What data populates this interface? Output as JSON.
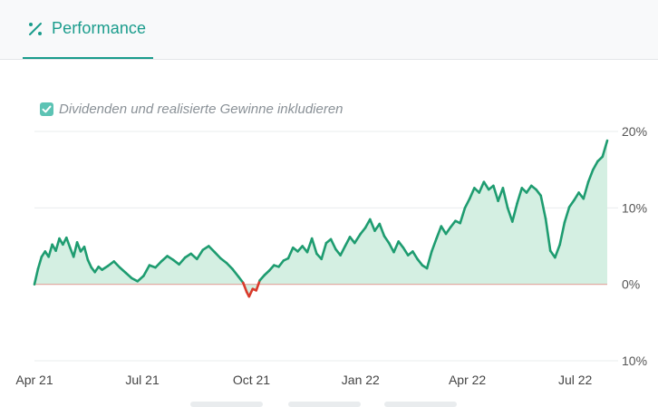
{
  "tab": {
    "label": "Performance",
    "icon": "percent-icon",
    "accent": "#1a9c8c"
  },
  "options": {
    "include_dividends_label": "Dividenden und realisierte Gewinne inkludieren",
    "include_dividends_checked": true
  },
  "chart_data": {
    "type": "area",
    "title": "",
    "xlabel": "",
    "ylabel": "",
    "y_axis_side": "right",
    "y_ticks": [
      20,
      10,
      0,
      -10
    ],
    "y_tick_labels": [
      "20%",
      "10%",
      "0%",
      "10%"
    ],
    "ylim": [
      -10,
      20
    ],
    "x_tick_labels": [
      "Apr 21",
      "Jul 21",
      "Oct 21",
      "Jan 22",
      "Apr 22",
      "Jul 22"
    ],
    "x_tick_dates": [
      "2021-04-01",
      "2021-07-01",
      "2021-10-01",
      "2022-01-01",
      "2022-04-01",
      "2022-07-01"
    ],
    "grid": true,
    "colors": {
      "positive_line": "#1e9c70",
      "positive_fill": "#d4efe2",
      "negative_line": "#d93a2b",
      "negative_fill": "#f6d3cf",
      "zero_line": "#e0a39a"
    },
    "series": [
      {
        "values_unit": "%",
        "points": [
          [
            "2021-04-01",
            0.0
          ],
          [
            "2021-04-04",
            2.0
          ],
          [
            "2021-04-07",
            3.6
          ],
          [
            "2021-04-10",
            4.3
          ],
          [
            "2021-04-13",
            3.6
          ],
          [
            "2021-04-16",
            5.2
          ],
          [
            "2021-04-19",
            4.4
          ],
          [
            "2021-04-22",
            6.0
          ],
          [
            "2021-04-25",
            5.2
          ],
          [
            "2021-04-28",
            6.1
          ],
          [
            "2021-05-01",
            4.8
          ],
          [
            "2021-05-04",
            3.6
          ],
          [
            "2021-05-07",
            5.5
          ],
          [
            "2021-05-10",
            4.3
          ],
          [
            "2021-05-13",
            4.9
          ],
          [
            "2021-05-16",
            3.2
          ],
          [
            "2021-05-19",
            2.2
          ],
          [
            "2021-05-22",
            1.6
          ],
          [
            "2021-05-25",
            2.3
          ],
          [
            "2021-05-28",
            1.9
          ],
          [
            "2021-06-02",
            2.4
          ],
          [
            "2021-06-07",
            3.0
          ],
          [
            "2021-06-12",
            2.2
          ],
          [
            "2021-06-17",
            1.5
          ],
          [
            "2021-06-22",
            0.8
          ],
          [
            "2021-06-27",
            0.4
          ],
          [
            "2021-07-02",
            1.1
          ],
          [
            "2021-07-07",
            2.5
          ],
          [
            "2021-07-12",
            2.2
          ],
          [
            "2021-07-17",
            3.0
          ],
          [
            "2021-07-22",
            3.7
          ],
          [
            "2021-07-27",
            3.2
          ],
          [
            "2021-08-01",
            2.6
          ],
          [
            "2021-08-06",
            3.5
          ],
          [
            "2021-08-11",
            4.0
          ],
          [
            "2021-08-16",
            3.3
          ],
          [
            "2021-08-21",
            4.5
          ],
          [
            "2021-08-26",
            5.0
          ],
          [
            "2021-08-31",
            4.2
          ],
          [
            "2021-09-05",
            3.4
          ],
          [
            "2021-09-10",
            2.8
          ],
          [
            "2021-09-15",
            2.0
          ],
          [
            "2021-09-20",
            1.0
          ],
          [
            "2021-09-24",
            0.2
          ],
          [
            "2021-09-27",
            -1.0
          ],
          [
            "2021-09-29",
            -1.6
          ],
          [
            "2021-10-02",
            -0.6
          ],
          [
            "2021-10-05",
            -0.8
          ],
          [
            "2021-10-08",
            0.5
          ],
          [
            "2021-10-12",
            1.2
          ],
          [
            "2021-10-16",
            1.8
          ],
          [
            "2021-10-20",
            2.5
          ],
          [
            "2021-10-24",
            2.3
          ],
          [
            "2021-10-28",
            3.1
          ],
          [
            "2021-11-01",
            3.4
          ],
          [
            "2021-11-05",
            4.8
          ],
          [
            "2021-11-09",
            4.3
          ],
          [
            "2021-11-13",
            5.0
          ],
          [
            "2021-11-17",
            4.2
          ],
          [
            "2021-11-21",
            6.0
          ],
          [
            "2021-11-25",
            4.0
          ],
          [
            "2021-11-29",
            3.3
          ],
          [
            "2021-12-03",
            5.4
          ],
          [
            "2021-12-07",
            5.9
          ],
          [
            "2021-12-11",
            4.6
          ],
          [
            "2021-12-15",
            3.8
          ],
          [
            "2021-12-19",
            5.0
          ],
          [
            "2021-12-23",
            6.2
          ],
          [
            "2021-12-27",
            5.4
          ],
          [
            "2022-01-01",
            6.6
          ],
          [
            "2022-01-05",
            7.4
          ],
          [
            "2022-01-09",
            8.5
          ],
          [
            "2022-01-13",
            7.0
          ],
          [
            "2022-01-17",
            7.9
          ],
          [
            "2022-01-21",
            6.3
          ],
          [
            "2022-01-25",
            5.4
          ],
          [
            "2022-01-29",
            4.2
          ],
          [
            "2022-02-02",
            5.6
          ],
          [
            "2022-02-06",
            4.8
          ],
          [
            "2022-02-10",
            3.8
          ],
          [
            "2022-02-14",
            4.3
          ],
          [
            "2022-02-18",
            3.3
          ],
          [
            "2022-02-22",
            2.5
          ],
          [
            "2022-02-26",
            2.1
          ],
          [
            "2022-03-02",
            4.3
          ],
          [
            "2022-03-06",
            6.0
          ],
          [
            "2022-03-10",
            7.6
          ],
          [
            "2022-03-14",
            6.6
          ],
          [
            "2022-03-18",
            7.5
          ],
          [
            "2022-03-22",
            8.3
          ],
          [
            "2022-03-26",
            8.0
          ],
          [
            "2022-03-30",
            10.0
          ],
          [
            "2022-04-03",
            11.2
          ],
          [
            "2022-04-07",
            12.6
          ],
          [
            "2022-04-11",
            12.0
          ],
          [
            "2022-04-15",
            13.4
          ],
          [
            "2022-04-19",
            12.4
          ],
          [
            "2022-04-23",
            12.9
          ],
          [
            "2022-04-27",
            10.9
          ],
          [
            "2022-05-01",
            12.6
          ],
          [
            "2022-05-05",
            10.0
          ],
          [
            "2022-05-09",
            8.2
          ],
          [
            "2022-05-13",
            10.6
          ],
          [
            "2022-05-17",
            12.6
          ],
          [
            "2022-05-21",
            12.0
          ],
          [
            "2022-05-25",
            12.9
          ],
          [
            "2022-05-29",
            12.4
          ],
          [
            "2022-06-02",
            11.6
          ],
          [
            "2022-06-06",
            8.6
          ],
          [
            "2022-06-10",
            4.4
          ],
          [
            "2022-06-14",
            3.5
          ],
          [
            "2022-06-18",
            5.2
          ],
          [
            "2022-06-22",
            8.1
          ],
          [
            "2022-06-26",
            10.1
          ],
          [
            "2022-06-30",
            11.0
          ],
          [
            "2022-07-04",
            12.0
          ],
          [
            "2022-07-08",
            11.2
          ],
          [
            "2022-07-12",
            13.4
          ],
          [
            "2022-07-16",
            15.0
          ],
          [
            "2022-07-20",
            16.1
          ],
          [
            "2022-07-24",
            16.7
          ],
          [
            "2022-07-28",
            18.8
          ]
        ]
      }
    ]
  }
}
